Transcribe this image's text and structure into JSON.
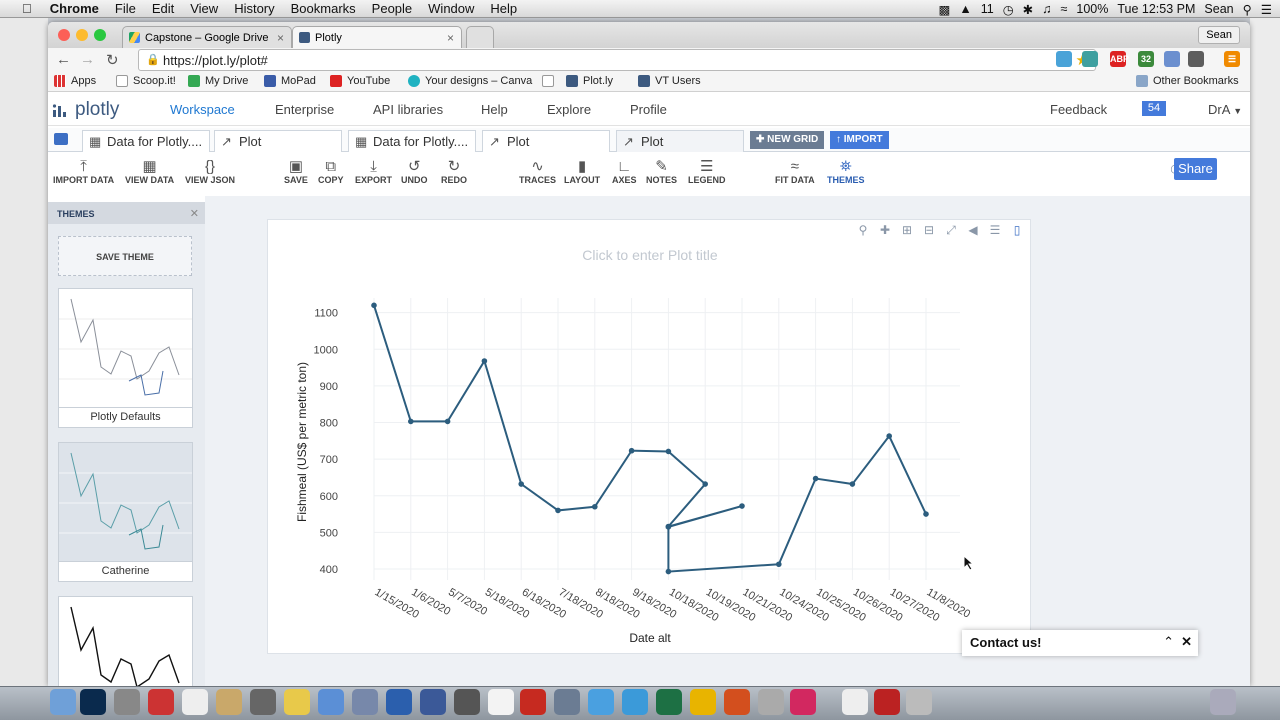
{
  "menubar": {
    "app": "Chrome",
    "items": [
      "File",
      "Edit",
      "View",
      "History",
      "Bookmarks",
      "People",
      "Window",
      "Help"
    ],
    "status": {
      "notifications": "11",
      "battery": "100%",
      "clock": "Tue 12:53 PM",
      "user": "Sean"
    }
  },
  "browser": {
    "tabs": [
      {
        "label": "Capstone – Google Drive",
        "active": false
      },
      {
        "label": "Plotly",
        "active": true
      }
    ],
    "profile": "Sean",
    "url": "https://plot.ly/plot#",
    "extensions": [
      {
        "name": "abp",
        "badge": "ABP"
      },
      {
        "name": "counter",
        "badge": "32"
      }
    ],
    "bookmarks": [
      "Apps",
      "Scoop.it!",
      "My Drive",
      "MoPad",
      "YouTube",
      "Your designs – Canva",
      "Plot.ly",
      "VT Users"
    ],
    "other_bookmarks": "Other Bookmarks"
  },
  "plotly": {
    "logo": "plotly",
    "nav": [
      {
        "label": "Workspace",
        "active": true
      },
      {
        "label": "Enterprise"
      },
      {
        "label": "API libraries"
      },
      {
        "label": "Help"
      },
      {
        "label": "Explore"
      },
      {
        "label": "Profile"
      }
    ],
    "feedback": "Feedback",
    "badge": "54",
    "user": "DrA",
    "tabs": [
      {
        "label": "Data for Plotly....",
        "icon": "grid-icon"
      },
      {
        "label": "Plot",
        "icon": "chart-icon"
      },
      {
        "label": "Data for Plotly....",
        "icon": "grid-icon"
      },
      {
        "label": "Plot",
        "icon": "chart-icon"
      },
      {
        "label": "Plot",
        "icon": "chart-icon",
        "active": true
      }
    ],
    "new_grid": "NEW GRID",
    "import": "IMPORT",
    "ribbon": [
      {
        "label": "IMPORT DATA",
        "icon": "upload-icon"
      },
      {
        "label": "VIEW DATA",
        "icon": "table-icon"
      },
      {
        "label": "VIEW JSON",
        "icon": "braces-icon"
      },
      {
        "label": "SAVE",
        "icon": "save-icon"
      },
      {
        "label": "COPY",
        "icon": "copy-icon"
      },
      {
        "label": "EXPORT",
        "icon": "download-icon"
      },
      {
        "label": "UNDO",
        "icon": "undo-icon"
      },
      {
        "label": "REDO",
        "icon": "redo-icon"
      },
      {
        "label": "TRACES",
        "icon": "traces-icon"
      },
      {
        "label": "LAYOUT",
        "icon": "layout-icon"
      },
      {
        "label": "AXES",
        "icon": "axes-icon"
      },
      {
        "label": "NOTES",
        "icon": "notes-icon"
      },
      {
        "label": "LEGEND",
        "icon": "legend-icon"
      },
      {
        "label": "FIT DATA",
        "icon": "fit-icon"
      },
      {
        "label": "THEMES",
        "icon": "themes-icon"
      }
    ],
    "share": "Share",
    "themes_panel": {
      "title": "THEMES",
      "save": "SAVE THEME",
      "cards": [
        {
          "label": "Plotly Defaults",
          "color": "#8a8f99"
        },
        {
          "label": "Catherine",
          "color": "#5a9ea8"
        }
      ]
    },
    "contact": "Contact us!"
  },
  "chart_data": {
    "type": "line",
    "title": "Click to enter Plot title",
    "xlabel": "Date alt",
    "ylabel": "Fishmeal (US$ per metric ton)",
    "x": [
      "1/15/2020",
      "1/6/2020",
      "5/7/2020",
      "5/18/2020",
      "6/18/2020",
      "7/18/2020",
      "8/18/2020",
      "9/18/2020",
      "10/18/2020",
      "10/19/2020",
      "10/18/2020",
      "10/21/2020",
      "10/18/2020",
      "10/18/2020",
      "10/24/2020",
      "10/25/2020",
      "10/26/2020",
      "10/27/2020",
      "11/8/2020"
    ],
    "categories": [
      "1/15/2020",
      "1/6/2020",
      "5/7/2020",
      "5/18/2020",
      "6/18/2020",
      "7/18/2020",
      "8/18/2020",
      "9/18/2020",
      "10/18/2020",
      "10/19/2020",
      "10/21/2020",
      "10/24/2020",
      "10/25/2020",
      "10/26/2020",
      "10/27/2020",
      "11/8/2020"
    ],
    "y": [
      1120,
      803,
      803,
      968,
      632,
      560,
      570,
      723,
      721,
      632,
      516,
      572,
      515,
      393,
      413,
      647,
      632,
      763,
      550
    ],
    "ylim": [
      370,
      1140
    ],
    "yticks": [
      400,
      500,
      600,
      700,
      800,
      900,
      1000,
      1100
    ],
    "color": "#2c5d7e",
    "grid": true
  }
}
